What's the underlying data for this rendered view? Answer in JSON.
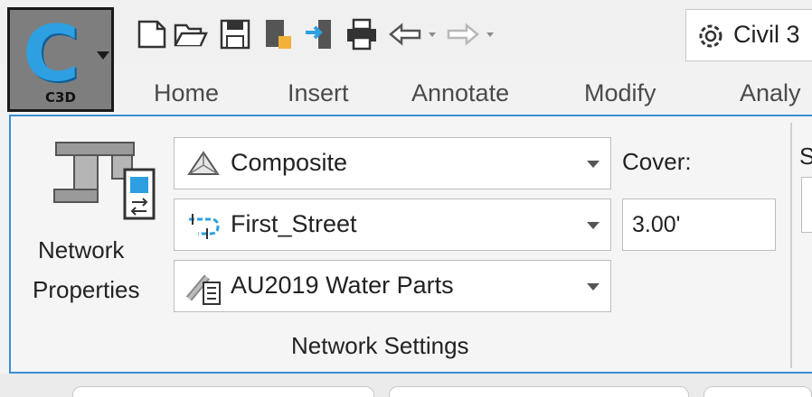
{
  "app_button": {
    "label": "C3D",
    "letter": "C"
  },
  "qat": {
    "workspace_label": "Civil 3",
    "icons": [
      "new-icon",
      "open-icon",
      "save-icon",
      "save-as-icon",
      "import-icon",
      "print-icon",
      "undo-icon",
      "redo-icon"
    ]
  },
  "tabs": [
    "Home",
    "Insert",
    "Annotate",
    "Modify",
    "Analy"
  ],
  "network_properties": {
    "line1": "Network",
    "line2": "Properties"
  },
  "settings": {
    "surface": {
      "value": "Composite",
      "icon": "surface-icon"
    },
    "alignment": {
      "value": "First_Street",
      "icon": "alignment-icon"
    },
    "parts_list": {
      "value": "AU2019 Water Parts",
      "icon": "parts-list-icon"
    },
    "cover_label": "Cover:",
    "cover_value": "3.00'",
    "panel_title": "Network Settings",
    "cut_label": "S"
  },
  "colors": {
    "accent": "#3a8fd6",
    "app_button": "#7e7e7e",
    "c_blue": "#2e9fe0"
  }
}
